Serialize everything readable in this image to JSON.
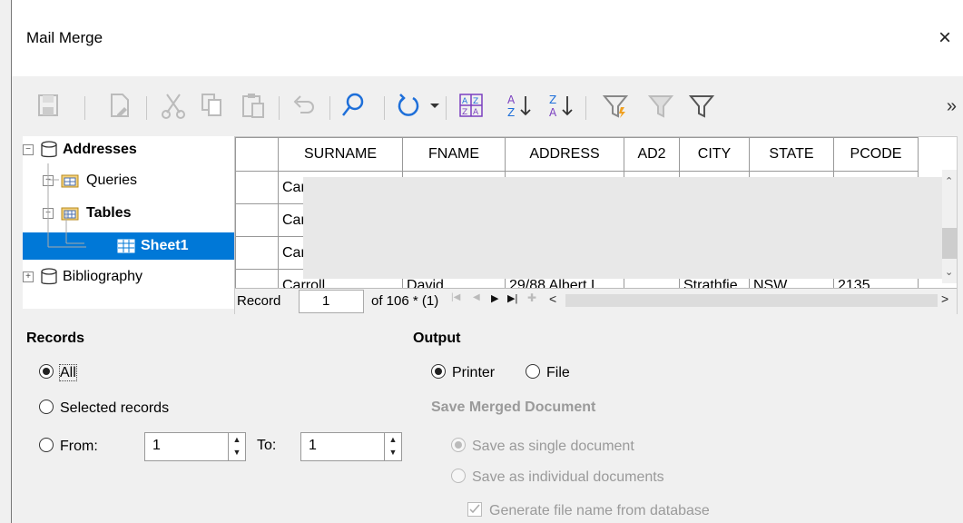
{
  "window": {
    "title": "Mail Merge",
    "close_glyph": "×"
  },
  "toolbar": {
    "icons": [
      "save-icon",
      "edit-icon",
      "cut-icon",
      "copy-icon",
      "paste-icon",
      "undo-icon",
      "find-icon",
      "refresh-icon",
      "sort-icon",
      "sort-ascending-icon",
      "sort-descending-icon",
      "autofilter-icon",
      "standard-filter-icon",
      "reset-filter-icon"
    ],
    "more_glyph": "»"
  },
  "tree": {
    "items": [
      {
        "label": "Addresses",
        "expander": "−"
      },
      {
        "label": "Queries",
        "expander": "+"
      },
      {
        "label": "Tables",
        "expander": "−"
      },
      {
        "label": "Sheet1"
      },
      {
        "label": "Bibliography",
        "expander": "+"
      }
    ]
  },
  "grid": {
    "columns": [
      "SURNAME",
      "FNAME",
      "ADDRESS",
      "AD2",
      "CITY",
      "STATE",
      "PCODE"
    ],
    "rows": [
      [
        "Car",
        "",
        "",
        "",
        "",
        "",
        ""
      ],
      [
        "Car",
        "",
        "",
        "",
        "",
        "",
        ""
      ],
      [
        "Car",
        "",
        "",
        "",
        "",
        "",
        ""
      ],
      [
        "Carroll",
        "David",
        "29/88 Albert I",
        "",
        "Strathfie",
        "NSW",
        "2135"
      ]
    ],
    "nav": {
      "record_label": "Record",
      "record_value": "1",
      "of_text": "of 106 * (1)"
    }
  },
  "records": {
    "heading": "Records",
    "all": "All",
    "selected": "Selected records",
    "from": "From:",
    "from_value": "1",
    "to": "To:",
    "to_value": "1"
  },
  "output": {
    "heading": "Output",
    "printer": "Printer",
    "file": "File",
    "save_heading": "Save Merged Document",
    "single": "Save as single document",
    "individual": "Save as individual documents",
    "generate": "Generate file name from database"
  }
}
